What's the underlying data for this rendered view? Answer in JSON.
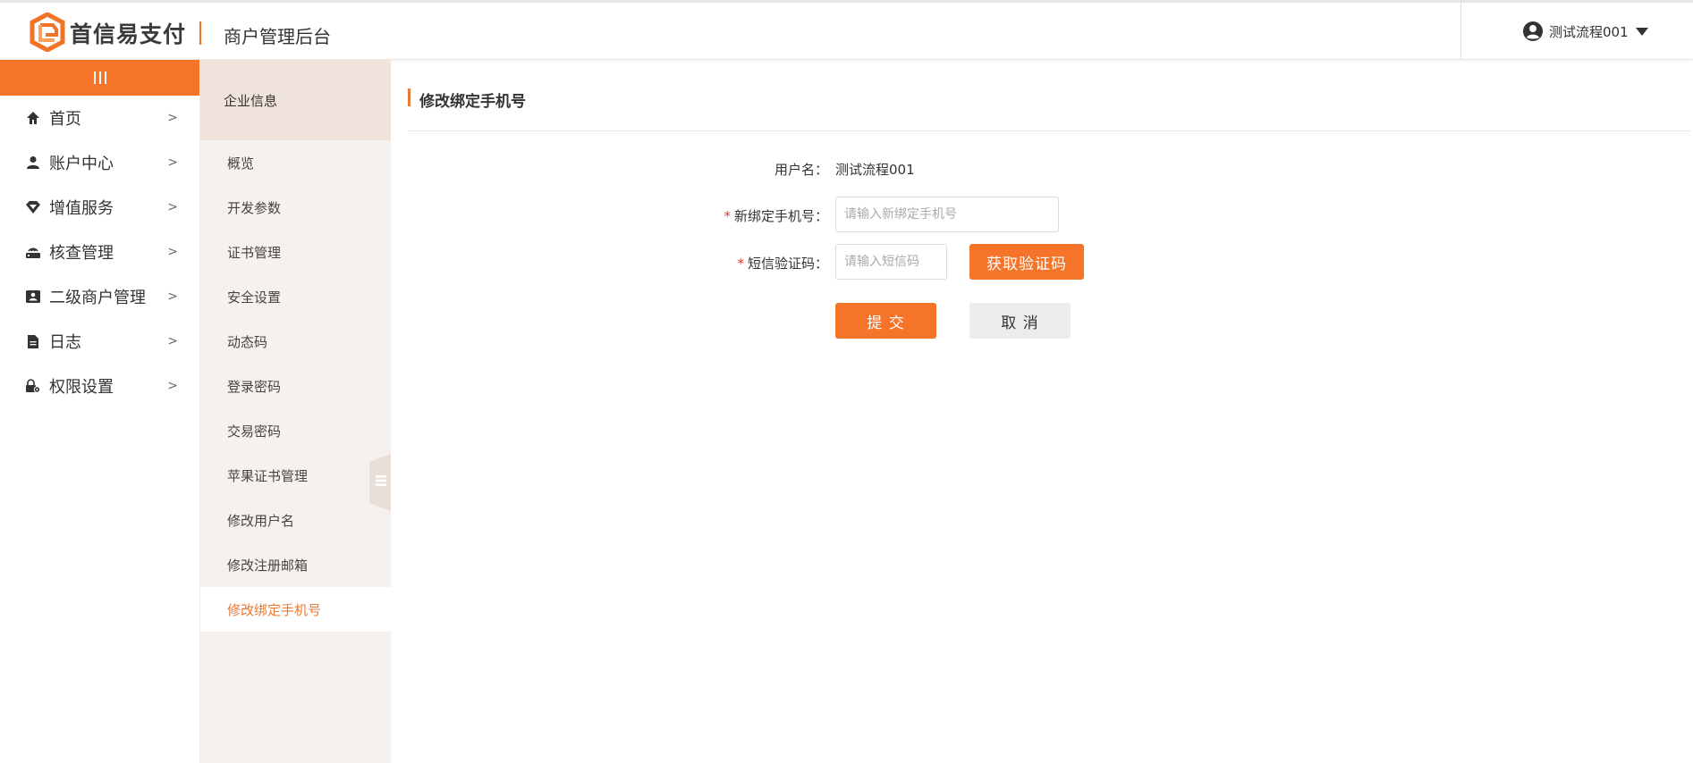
{
  "header": {
    "brand": "首信易支付",
    "app_title": "商户管理后台",
    "user_name": "测试流程001"
  },
  "colors": {
    "accent": "#f57429",
    "active_text": "#e87a35",
    "subnav_bg": "#f6f1ee",
    "subnav_head_bg": "#f0e3dc"
  },
  "sidebar": {
    "items": [
      {
        "label": "首页",
        "icon": "home-icon"
      },
      {
        "label": "账户中心",
        "icon": "user-icon"
      },
      {
        "label": "增值服务",
        "icon": "diamond-icon"
      },
      {
        "label": "核查管理",
        "icon": "router-icon"
      },
      {
        "label": "二级商户管理",
        "icon": "id-card-icon"
      },
      {
        "label": "日志",
        "icon": "file-icon"
      },
      {
        "label": "权限设置",
        "icon": "lock-gear-icon"
      }
    ]
  },
  "subnav": {
    "heading": "企业信息",
    "items": [
      {
        "label": "概览"
      },
      {
        "label": "开发参数"
      },
      {
        "label": "证书管理"
      },
      {
        "label": "安全设置"
      },
      {
        "label": "动态码"
      },
      {
        "label": "登录密码"
      },
      {
        "label": "交易密码"
      },
      {
        "label": "苹果证书管理"
      },
      {
        "label": "修改用户名"
      },
      {
        "label": "修改注册邮箱"
      },
      {
        "label": "修改绑定手机号",
        "active": true
      }
    ]
  },
  "main": {
    "title": "修改绑定手机号",
    "form": {
      "username_label": "用户名：",
      "username_value": "测试流程001",
      "phone_label": "新绑定手机号：",
      "phone_placeholder": "请输入新绑定手机号",
      "sms_label": "短信验证码：",
      "sms_placeholder": "请输入短信码",
      "required_mark": "*",
      "get_code_label": "获取验证码",
      "submit_label": "提 交",
      "cancel_label": "取 消"
    }
  }
}
